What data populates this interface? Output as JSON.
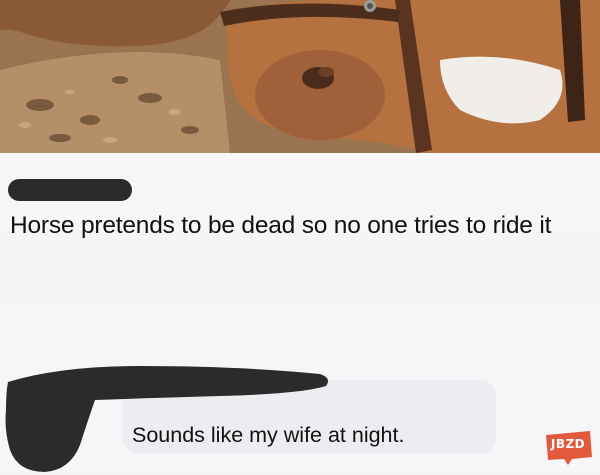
{
  "post": {
    "text": "Horse pretends to be dead so no one tries to ride it"
  },
  "comment": {
    "text": "Sounds like my wife at night."
  },
  "watermark": {
    "text": "JBZD"
  },
  "colors": {
    "redaction": "#2b2b2b",
    "post_background": "#f3f4f6",
    "bubble_background": "#ebedf0",
    "watermark": "#e25a3e"
  }
}
